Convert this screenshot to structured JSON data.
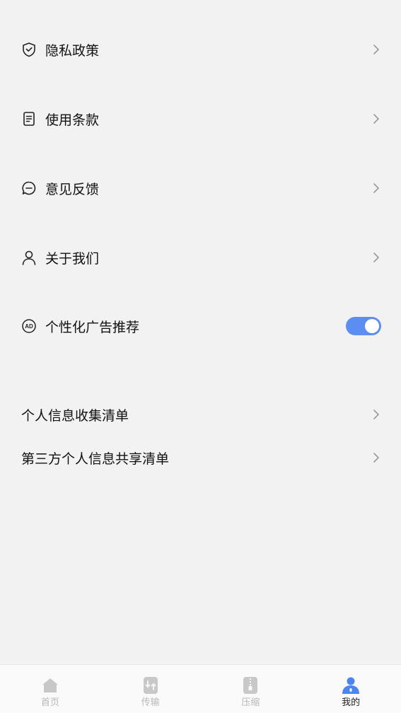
{
  "menu": {
    "privacy_policy": "隐私政策",
    "terms_of_use": "使用条款",
    "feedback": "意见反馈",
    "about_us": "关于我们",
    "personalized_ads": "个性化广告推荐",
    "personalized_ads_enabled": true
  },
  "lists": {
    "personal_info_collection": "个人信息收集清单",
    "third_party_sharing": "第三方个人信息共享清单"
  },
  "tabbar": {
    "home": "首页",
    "transfer": "传输",
    "compress": "压缩",
    "mine": "我的",
    "active_tab": "mine"
  },
  "colors": {
    "accent": "#5b8ef0",
    "background": "#f2f2f2",
    "inactive_tab": "#b8b8b8"
  }
}
